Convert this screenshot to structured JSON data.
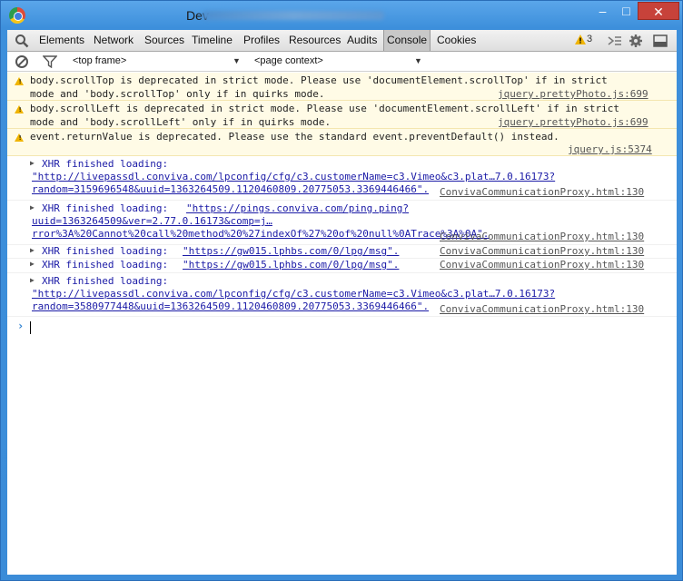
{
  "window": {
    "title": "Dev",
    "controls": {
      "minimize": "–",
      "maximize": "□",
      "close": "✕"
    }
  },
  "tabs": [
    "Elements",
    "Network",
    "Sources",
    "Timeline",
    "Profiles",
    "Resources",
    "Audits",
    "Console",
    "Cookies"
  ],
  "active_tab": "Console",
  "toolbar": {
    "warning_count": "3"
  },
  "filter": {
    "frame": "<top frame>",
    "context": "<page context>"
  },
  "messages": {
    "m1": {
      "line1": "body.scrollTop is deprecated in strict mode. Please use 'documentElement.scrollTop' if in strict",
      "line2": "mode and 'body.scrollTop' only if in quirks mode.",
      "source": "jquery.prettyPhoto.js:699"
    },
    "m2": {
      "line1": "body.scrollLeft is deprecated in strict mode. Please use 'documentElement.scrollLeft' if in strict",
      "line2": "mode and 'body.scrollLeft' only if in quirks mode.",
      "source": "jquery.prettyPhoto.js:699"
    },
    "m3": {
      "line1": "event.returnValue is deprecated. Please use the standard event.preventDefault() instead.",
      "source": "jquery.js:5374"
    },
    "x1": {
      "label": "XHR finished loading: ",
      "url1": "\"http://livepassdl.conviva.com/lpconfig/cfg/c3.customerName=c3.Vimeo&c3.plat…7.0.16173?",
      "url2": "random=3159696548&uuid=1363264509.1120460809.20775053.3369446466\".",
      "source": "ConvivaCommunicationProxy.html:130"
    },
    "x2": {
      "label": "XHR finished loading: ",
      "url1": "\"https://pings.conviva.com/ping.ping?",
      "url2": "uuid=1363264509&ver=2.77.0.16173&comp=j…",
      "url3": "rror%3A%20Cannot%20call%20method%20%27indexOf%27%20of%20null%0ATrace%3A%0A\".",
      "source": "ConvivaCommunicationProxy.html:130"
    },
    "x3": {
      "label": "XHR finished loading: ",
      "url": "\"https://gw015.lphbs.com/0/lpg/msg\".",
      "source": "ConvivaCommunicationProxy.html:130"
    },
    "x4": {
      "label": "XHR finished loading: ",
      "url": "\"https://gw015.lphbs.com/0/lpg/msg\".",
      "source": "ConvivaCommunicationProxy.html:130"
    },
    "x5": {
      "label": "XHR finished loading: ",
      "url1": "\"http://livepassdl.conviva.com/lpconfig/cfg/c3.customerName=c3.Vimeo&c3.plat…7.0.16173?",
      "url2": "random=3580977448&uuid=1363264509.1120460809.20775053.3369446466\".",
      "source": "ConvivaCommunicationProxy.html:130"
    }
  },
  "prompt_symbol": "›"
}
